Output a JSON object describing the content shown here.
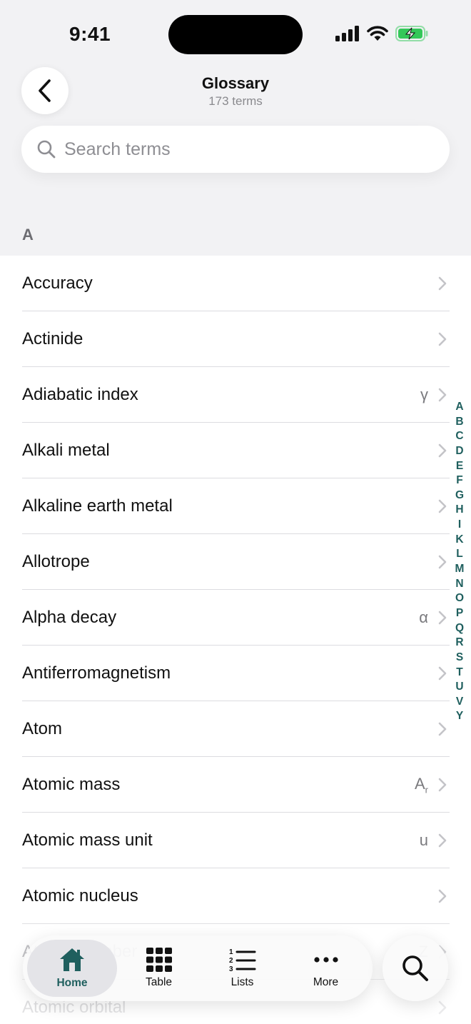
{
  "status_bar": {
    "time": "9:41"
  },
  "header": {
    "title": "Glossary",
    "subtitle": "173 terms"
  },
  "search": {
    "placeholder": "Search terms"
  },
  "section": {
    "letter": "A"
  },
  "terms": [
    {
      "label": "Accuracy",
      "symbol": ""
    },
    {
      "label": "Actinide",
      "symbol": ""
    },
    {
      "label": "Adiabatic index",
      "symbol": "γ"
    },
    {
      "label": "Alkali metal",
      "symbol": ""
    },
    {
      "label": "Alkaline earth metal",
      "symbol": ""
    },
    {
      "label": "Allotrope",
      "symbol": ""
    },
    {
      "label": "Alpha decay",
      "symbol": "α"
    },
    {
      "label": "Antiferromagnetism",
      "symbol": ""
    },
    {
      "label": "Atom",
      "symbol": ""
    },
    {
      "label": "Atomic mass",
      "symbol": "Ar"
    },
    {
      "label": "Atomic mass unit",
      "symbol": "u"
    },
    {
      "label": "Atomic nucleus",
      "symbol": ""
    },
    {
      "label": "Atomic number",
      "symbol": "Z"
    },
    {
      "label": "Atomic orbital",
      "symbol": ""
    }
  ],
  "index_letters": [
    "A",
    "B",
    "C",
    "D",
    "E",
    "F",
    "G",
    "H",
    "I",
    "K",
    "L",
    "M",
    "N",
    "O",
    "P",
    "Q",
    "R",
    "S",
    "T",
    "U",
    "V",
    "Y"
  ],
  "tabs": [
    {
      "label": "Home",
      "icon": "home-icon",
      "active": true
    },
    {
      "label": "Table",
      "icon": "grid-icon",
      "active": false
    },
    {
      "label": "Lists",
      "icon": "numbered-list-icon",
      "active": false
    },
    {
      "label": "More",
      "icon": "more-icon",
      "active": false
    }
  ],
  "colors": {
    "accent": "#1f5f5e",
    "battery": "#34c759"
  }
}
